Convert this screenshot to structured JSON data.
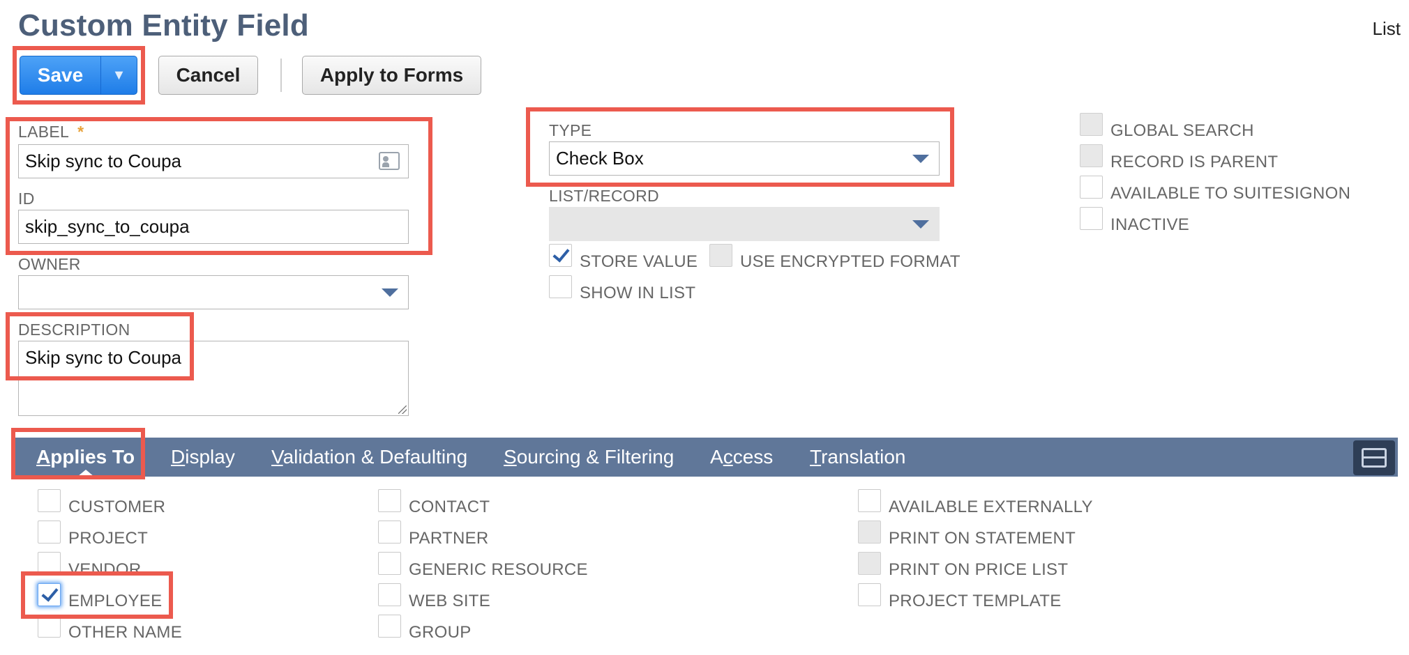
{
  "page": {
    "title": "Custom Entity Field",
    "list_link": "List"
  },
  "toolbar": {
    "save_label": "Save",
    "save_dropdown_glyph": "▼",
    "cancel_label": "Cancel",
    "apply_forms_label": "Apply to Forms"
  },
  "fields": {
    "label": {
      "caption": "LABEL",
      "required_mark": "*",
      "value": "Skip sync to Coupa"
    },
    "id": {
      "caption": "ID",
      "value": "skip_sync_to_coupa"
    },
    "owner": {
      "caption": "OWNER",
      "value": ""
    },
    "description": {
      "caption": "DESCRIPTION",
      "value": "Skip sync to Coupa"
    },
    "type": {
      "caption": "TYPE",
      "value": "Check Box"
    },
    "list_record": {
      "caption": "LIST/RECORD",
      "value": ""
    }
  },
  "options": {
    "store_value": {
      "label": "STORE VALUE",
      "checked": true
    },
    "use_encrypted_format": {
      "label": "USE ENCRYPTED FORMAT",
      "checked": false
    },
    "show_in_list": {
      "label": "SHOW IN LIST",
      "checked": false
    },
    "global_search": {
      "label": "GLOBAL SEARCH",
      "checked": false
    },
    "record_is_parent": {
      "label": "RECORD IS PARENT",
      "checked": false
    },
    "available_to_suitesignon": {
      "label": "AVAILABLE TO SUITESIGNON",
      "checked": false
    },
    "inactive": {
      "label": "INACTIVE",
      "checked": false
    }
  },
  "tabs": [
    {
      "label": "Applies To",
      "accesskey": "A",
      "rest": "pplies To",
      "active": true
    },
    {
      "label": "Display",
      "accesskey": "D",
      "rest": "isplay"
    },
    {
      "label": "Validation & Defaulting",
      "accesskey": "V",
      "rest": "alidation & Defaulting"
    },
    {
      "label": "Sourcing & Filtering",
      "accesskey": "S",
      "rest": "ourcing & Filtering"
    },
    {
      "label": "Access",
      "pre": "A",
      "accesskey": "c",
      "rest": "cess"
    },
    {
      "label": "Translation",
      "accesskey": "T",
      "rest": "ranslation"
    }
  ],
  "applies_to": {
    "col1": [
      {
        "label": "CUSTOMER",
        "checked": false
      },
      {
        "label": "PROJECT",
        "checked": false
      },
      {
        "label": "VENDOR",
        "checked": false
      },
      {
        "label": "EMPLOYEE",
        "checked": true
      },
      {
        "label": "OTHER NAME",
        "checked": false
      }
    ],
    "col2": [
      {
        "label": "CONTACT",
        "checked": false
      },
      {
        "label": "PARTNER",
        "checked": false
      },
      {
        "label": "GENERIC RESOURCE",
        "checked": false
      },
      {
        "label": "WEB SITE",
        "checked": false
      },
      {
        "label": "GROUP",
        "checked": false
      }
    ],
    "col3": [
      {
        "label": "AVAILABLE EXTERNALLY",
        "checked": false
      },
      {
        "label": "PRINT ON STATEMENT",
        "checked": false
      },
      {
        "label": "PRINT ON PRICE LIST",
        "checked": false
      },
      {
        "label": "PROJECT TEMPLATE",
        "checked": false
      }
    ]
  },
  "colors": {
    "title": "#4d5f79",
    "save_button": "#1f7de8",
    "tab_bar": "#607799",
    "highlight": "#ec5a4e",
    "checkmark": "#2d5fa7"
  }
}
